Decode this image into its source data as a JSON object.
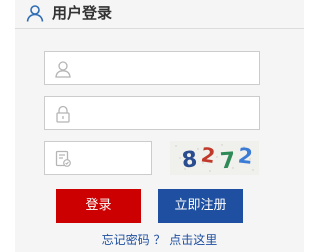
{
  "header": {
    "title": "用户登录",
    "icon": "user-outline-icon"
  },
  "form": {
    "username": {
      "icon": "user-icon",
      "value": "",
      "placeholder": ""
    },
    "password": {
      "icon": "lock-icon",
      "value": "",
      "placeholder": ""
    },
    "captcha_field": {
      "icon": "captcha-icon",
      "value": "",
      "placeholder": ""
    },
    "captcha_image": {
      "chars": [
        "8",
        "2",
        "7",
        "2"
      ],
      "colors": [
        "#2a4d8f",
        "#c0392b",
        "#2e8b57",
        "#3a7bd5"
      ]
    }
  },
  "buttons": {
    "login_label": "登录",
    "register_label": "立即注册"
  },
  "links": {
    "forgot_password": "忘记密码 ？ 点击这里"
  },
  "colors": {
    "login_button": "#cc0000",
    "register_button": "#1e4fa0",
    "link": "#1e4fa0",
    "panel_bg": "#f5f5f5"
  }
}
